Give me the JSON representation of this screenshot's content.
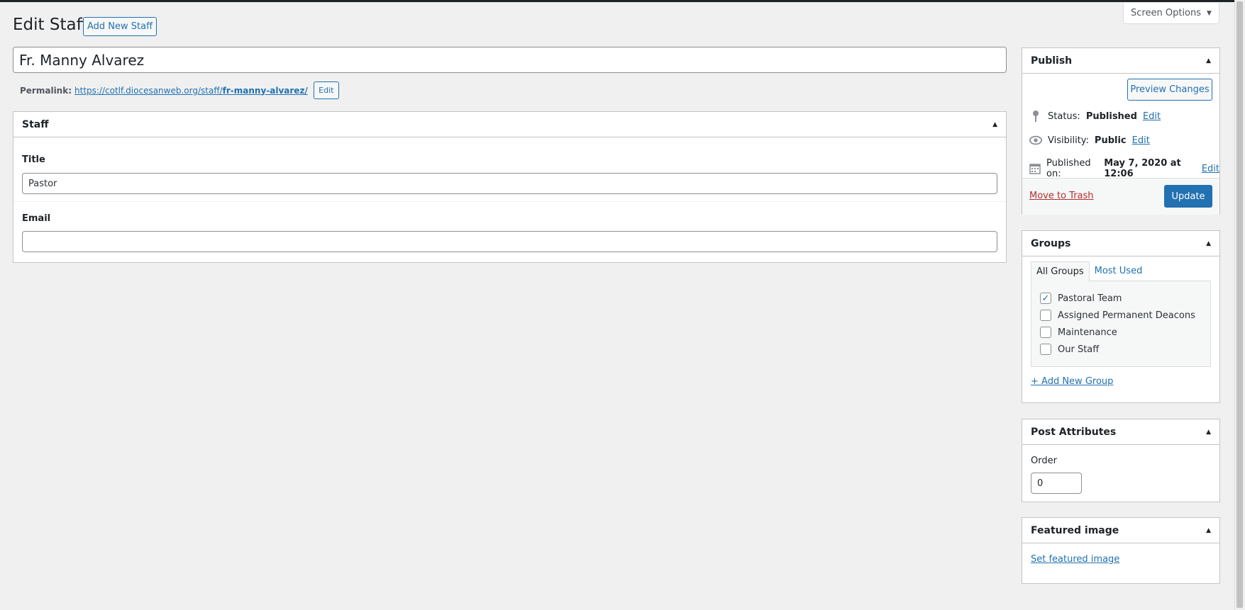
{
  "header": {
    "title": "Edit Staff",
    "add_new_label": "Add New Staff",
    "screen_options_label": "Screen Options"
  },
  "post": {
    "title_value": "Fr. Manny Alvarez",
    "permalink_label": "Permalink:",
    "permalink_base": "https://cotlf.diocesanweb.org/staff/",
    "permalink_slug": "fr-manny-alvarez/",
    "permalink_edit_label": "Edit"
  },
  "staff_box": {
    "heading": "Staff",
    "title_label": "Title",
    "title_value": "Pastor",
    "email_label": "Email",
    "email_value": ""
  },
  "publish": {
    "heading": "Publish",
    "preview_label": "Preview Changes",
    "status_label": "Status:",
    "status_value": "Published",
    "visibility_label": "Visibility:",
    "visibility_value": "Public",
    "published_label": "Published on:",
    "published_value": "May 7, 2020 at 12:06",
    "edit_label": "Edit",
    "trash_label": "Move to Trash",
    "update_label": "Update"
  },
  "groups": {
    "heading": "Groups",
    "tab_all": "All Groups",
    "tab_most_used": "Most Used",
    "items": [
      {
        "label": "Pastoral Team",
        "checked": true
      },
      {
        "label": "Assigned Permanent Deacons",
        "checked": false
      },
      {
        "label": "Maintenance",
        "checked": false
      },
      {
        "label": "Our Staff",
        "checked": false
      }
    ],
    "add_new_label": "+ Add New Group"
  },
  "attributes": {
    "heading": "Post Attributes",
    "order_label": "Order",
    "order_value": "0"
  },
  "featured_image": {
    "heading": "Featured image",
    "set_label": "Set featured image"
  },
  "colors": {
    "primary": "#2271b1",
    "trash": "#b32d2e",
    "background": "#f0f0f1"
  }
}
